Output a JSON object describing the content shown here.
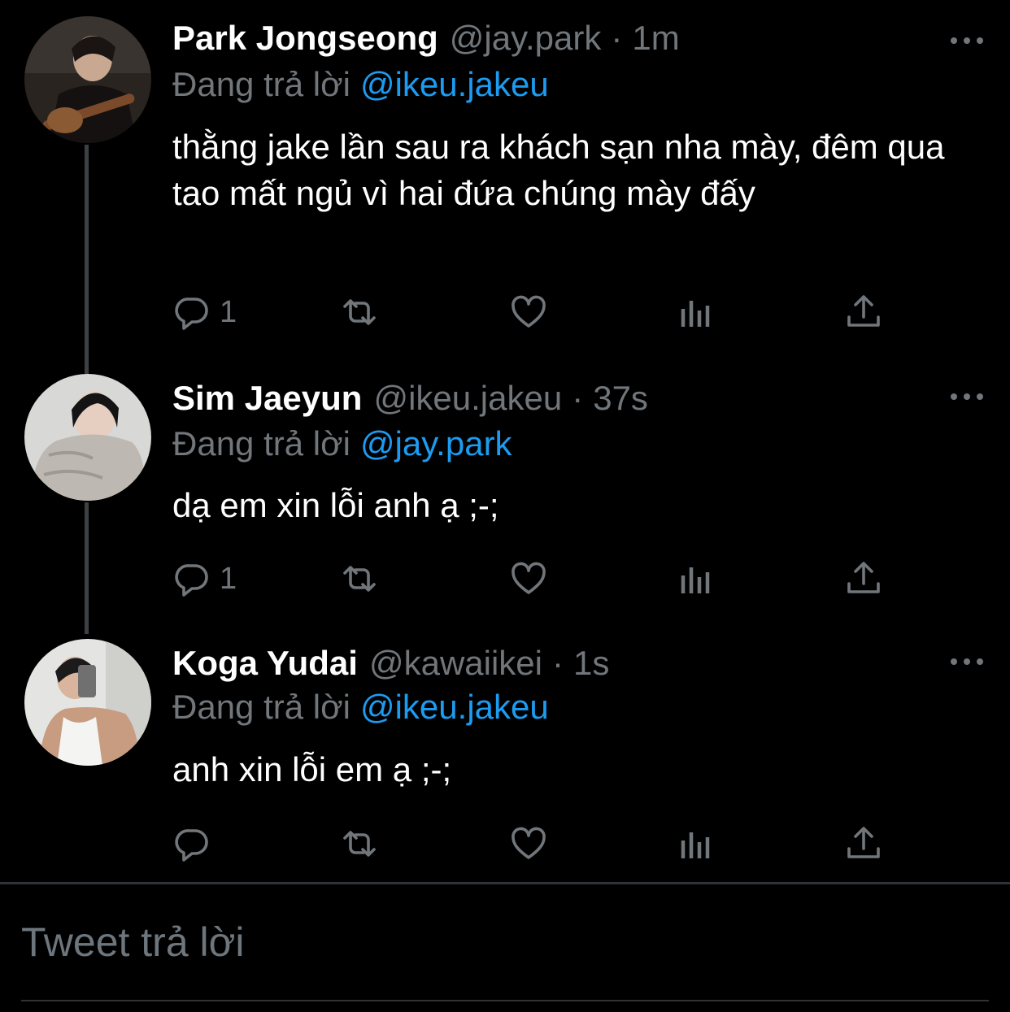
{
  "tweets": [
    {
      "name": "Park Jongseong",
      "handle": "@jay.park",
      "time": "1m",
      "replying_prefix": "Đang trả lời",
      "replying_to": "@ikeu.jakeu",
      "text": "thằng jake lần sau ra khách sạn nha mày, đêm qua tao mất ngủ vì hai đứa chúng mày đấy",
      "reply_count": "1"
    },
    {
      "name": "Sim Jaeyun",
      "handle": "@ikeu.jakeu",
      "time": "37s",
      "replying_prefix": "Đang trả lời",
      "replying_to": "@jay.park",
      "text": "dạ em xin lỗi anh ạ ;-;",
      "reply_count": "1"
    },
    {
      "name": "Koga Yudai",
      "handle": "@kawaiikei",
      "time": "1s",
      "replying_prefix": "Đang trả lời",
      "replying_to": "@ikeu.jakeu",
      "text": "anh xin lỗi em ạ ;-;",
      "reply_count": ""
    }
  ],
  "separator": "·",
  "compose": {
    "placeholder": "Tweet trả lời"
  },
  "icons": {
    "reply": "reply-icon",
    "retweet": "retweet-icon",
    "like": "heart-icon",
    "analytics": "analytics-icon",
    "share": "share-icon",
    "more": "more-icon"
  },
  "colors": {
    "background": "#000000",
    "name": "#ffffff",
    "secondary": "#71767b",
    "mention": "#1d9bf0",
    "thread_line": "#3e4144"
  }
}
